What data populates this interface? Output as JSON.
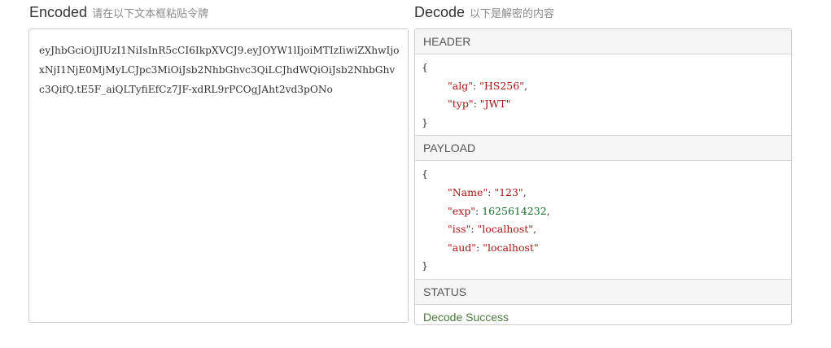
{
  "encoded": {
    "title": "Encoded",
    "subtitle": "请在以下文本框粘贴令牌",
    "token": "eyJhbGciOiJIUzI1NiIsInR5cCI6IkpXVCJ9.eyJOYW1lIjoiMTIzIiwiZXhwIjoxNjI1NjE0MjMyLCJpc3MiOiJsb2NhbGhvc3QiLCJhdWQiOiJsb2NhbGhvc3QifQ.tE5F_aiQLTyfiEfCz7JF-xdRL9rPCOgJAht2vd3pONo"
  },
  "decode": {
    "title": "Decode",
    "subtitle": "以下是解密的内容",
    "header": {
      "label": "HEADER",
      "open": "{",
      "close": "}",
      "fields": [
        {
          "key": "\"alg\"",
          "sep": ": ",
          "value": "\"HS256\"",
          "tail": ","
        },
        {
          "key": "\"typ\"",
          "sep": ": ",
          "value": "\"JWT\"",
          "tail": ""
        }
      ]
    },
    "payload": {
      "label": "PAYLOAD",
      "open": "{",
      "close": "}",
      "fields": [
        {
          "key": "\"Name\"",
          "sep": ": ",
          "value": "\"123\"",
          "tail": ","
        },
        {
          "key": "\"exp\"",
          "sep": ": ",
          "value": "1625614232",
          "tail": ","
        },
        {
          "key": "\"iss\"",
          "sep": ": ",
          "value": "\"localhost\"",
          "tail": ","
        },
        {
          "key": "\"aud\"",
          "sep": ": ",
          "value": "\"localhost\"",
          "tail": ""
        }
      ]
    },
    "status": {
      "label": "STATUS",
      "message": "Decode Success"
    }
  }
}
